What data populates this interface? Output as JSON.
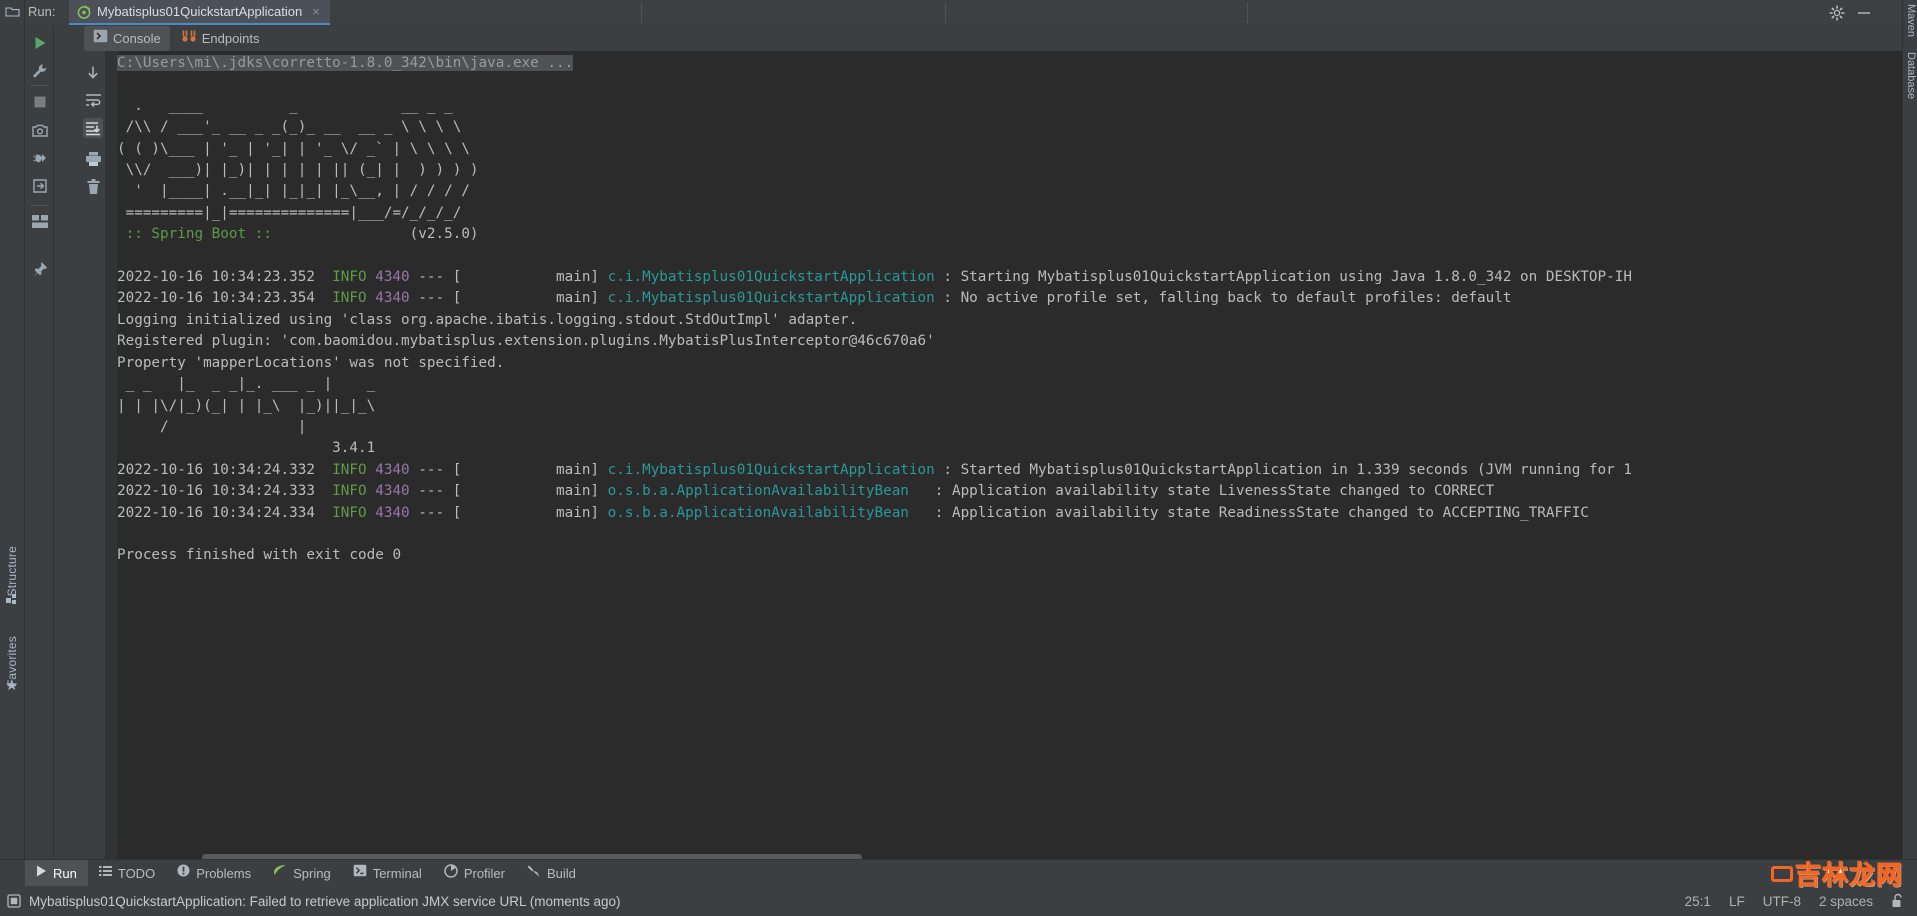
{
  "window": {
    "run_label": "Run:",
    "tab_title": "Mybatisplus01QuickstartApplication",
    "tab_close": "×",
    "settings_icon": "gear-icon",
    "minimize_icon": "minimize-icon"
  },
  "toolbar_left": [
    {
      "name": "rerun-button",
      "icon": "play-icon"
    },
    {
      "name": "edit-configurations-button",
      "icon": "wrench-icon"
    },
    {
      "name": "stop-button",
      "icon": "stop-square-icon"
    },
    {
      "name": "screenshot-button",
      "icon": "camera-icon"
    },
    {
      "name": "debug-attach-button",
      "icon": "bug-arrow-icon"
    },
    {
      "name": "import-button",
      "icon": "arrow-into-box-icon"
    },
    {
      "name": "layout-button",
      "icon": "layout-icon"
    },
    {
      "name": "pin-button",
      "icon": "pin-icon"
    }
  ],
  "toolbar_console": [
    {
      "name": "scroll-up-button",
      "icon": "arrow-up-icon"
    },
    {
      "name": "scroll-down-button",
      "icon": "arrow-down-icon"
    },
    {
      "name": "soft-wrap-button",
      "icon": "soft-wrap-icon"
    },
    {
      "name": "scroll-to-end-button",
      "icon": "scroll-to-end-icon",
      "active": true
    },
    {
      "name": "print-button",
      "icon": "printer-icon"
    },
    {
      "name": "clear-all-button",
      "icon": "trash-icon"
    }
  ],
  "tabs": [
    {
      "name": "tab-console",
      "label": "Console",
      "icon": "console-icon",
      "selected": true
    },
    {
      "name": "tab-endpoints",
      "label": "Endpoints",
      "icon": "endpoints-icon",
      "selected": false
    }
  ],
  "console": {
    "command_line": "C:\\Users\\mi\\.jdks\\corretto-1.8.0_342\\bin\\java.exe ...",
    "banner": [
      "  .   ____          _            __ _ _",
      " /\\\\ / ___'_ __ _ _(_)_ __  __ _ \\ \\ \\ \\",
      "( ( )\\___ | '_ | '_| | '_ \\/ _` | \\ \\ \\ \\",
      " \\\\/  ___)| |_)| | | | | || (_| |  ) ) ) )",
      "  '  |____| .__|_| |_|_| |_\\__, | / / / /",
      " =========|_|==============|___/=/_/_/_/"
    ],
    "spring_boot_label": " :: Spring Boot :: ",
    "spring_boot_version": "(v2.5.0)",
    "mybatis_banner": [
      " _ _   |_  _ _|_. ___ _ |    _",
      "| | |\\/|_)(_| | |_\\  |_)||_|_\\",
      "     /               |",
      "                         3.4.1"
    ],
    "log_lines": [
      {
        "timestamp": "2022-10-16 10:34:23.352",
        "level": "INFO",
        "pid": "4340",
        "dashes": "---",
        "thread": "[           main]",
        "logger": "c.i.Mybatisplus01QuickstartApplication",
        "separator": " : ",
        "message": "Starting Mybatisplus01QuickstartApplication using Java 1.8.0_342 on DESKTOP-IH"
      },
      {
        "timestamp": "2022-10-16 10:34:23.354",
        "level": "INFO",
        "pid": "4340",
        "dashes": "---",
        "thread": "[           main]",
        "logger": "c.i.Mybatisplus01QuickstartApplication",
        "separator": " : ",
        "message": "No active profile set, falling back to default profiles: default"
      }
    ],
    "plain_lines": [
      "Logging initialized using 'class org.apache.ibatis.logging.stdout.StdOutImpl' adapter.",
      "Registered plugin: 'com.baomidou.mybatisplus.extension.plugins.MybatisPlusInterceptor@46c670a6'",
      "Property 'mapperLocations' was not specified."
    ],
    "log_lines_2": [
      {
        "timestamp": "2022-10-16 10:34:24.332",
        "level": "INFO",
        "pid": "4340",
        "dashes": "---",
        "thread": "[           main]",
        "logger": "c.i.Mybatisplus01QuickstartApplication",
        "separator": " : ",
        "message": "Started Mybatisplus01QuickstartApplication in 1.339 seconds (JVM running for 1"
      },
      {
        "timestamp": "2022-10-16 10:34:24.333",
        "level": "INFO",
        "pid": "4340",
        "dashes": "---",
        "thread": "[           main]",
        "logger": "o.s.b.a.ApplicationAvailabilityBean",
        "separator": "   : ",
        "message": "Application availability state LivenessState changed to CORRECT"
      },
      {
        "timestamp": "2022-10-16 10:34:24.334",
        "level": "INFO",
        "pid": "4340",
        "dashes": "---",
        "thread": "[           main]",
        "logger": "o.s.b.a.ApplicationAvailabilityBean",
        "separator": "   : ",
        "message": "Application availability state ReadinessState changed to ACCEPTING_TRAFFIC"
      }
    ],
    "exit_line": "Process finished with exit code 0"
  },
  "left_strip": {
    "structure_label": "Structure",
    "favorites_label": "Favorites"
  },
  "right_strip": {
    "maven_label": "Maven",
    "database_label": "Database"
  },
  "bottom_tools": [
    {
      "name": "bottom-tab-run",
      "label": "Run",
      "icon": "play-icon",
      "active": true
    },
    {
      "name": "bottom-tab-todo",
      "label": "TODO",
      "icon": "list-icon",
      "active": false
    },
    {
      "name": "bottom-tab-problems",
      "label": "Problems",
      "icon": "error-icon",
      "active": false
    },
    {
      "name": "bottom-tab-spring",
      "label": "Spring",
      "icon": "leaf-icon",
      "active": false
    },
    {
      "name": "bottom-tab-terminal",
      "label": "Terminal",
      "icon": "terminal-icon",
      "active": false
    },
    {
      "name": "bottom-tab-profiler",
      "label": "Profiler",
      "icon": "profiler-icon",
      "active": false
    },
    {
      "name": "bottom-tab-build",
      "label": "Build",
      "icon": "hammer-icon",
      "active": false
    }
  ],
  "status_bar": {
    "message": "Mybatisplus01QuickstartApplication: Failed to retrieve application JMX service URL (moments ago)",
    "caret_position": "25:1",
    "line_separator": "LF",
    "encoding": "UTF-8",
    "indent": "2 spaces",
    "lock_icon": "unlock-icon"
  },
  "watermark": {
    "text": "吉林龙网"
  },
  "colors": {
    "accent_blue": "#4a88c7",
    "console_bg": "#2b2b2b",
    "panel_bg": "#3c3f41",
    "info_green": "#5f9b47",
    "pid_magenta": "#9876aa",
    "logger_cyan": "#299999",
    "spring_green": "#6a8759",
    "text": "#bbbbbb"
  }
}
